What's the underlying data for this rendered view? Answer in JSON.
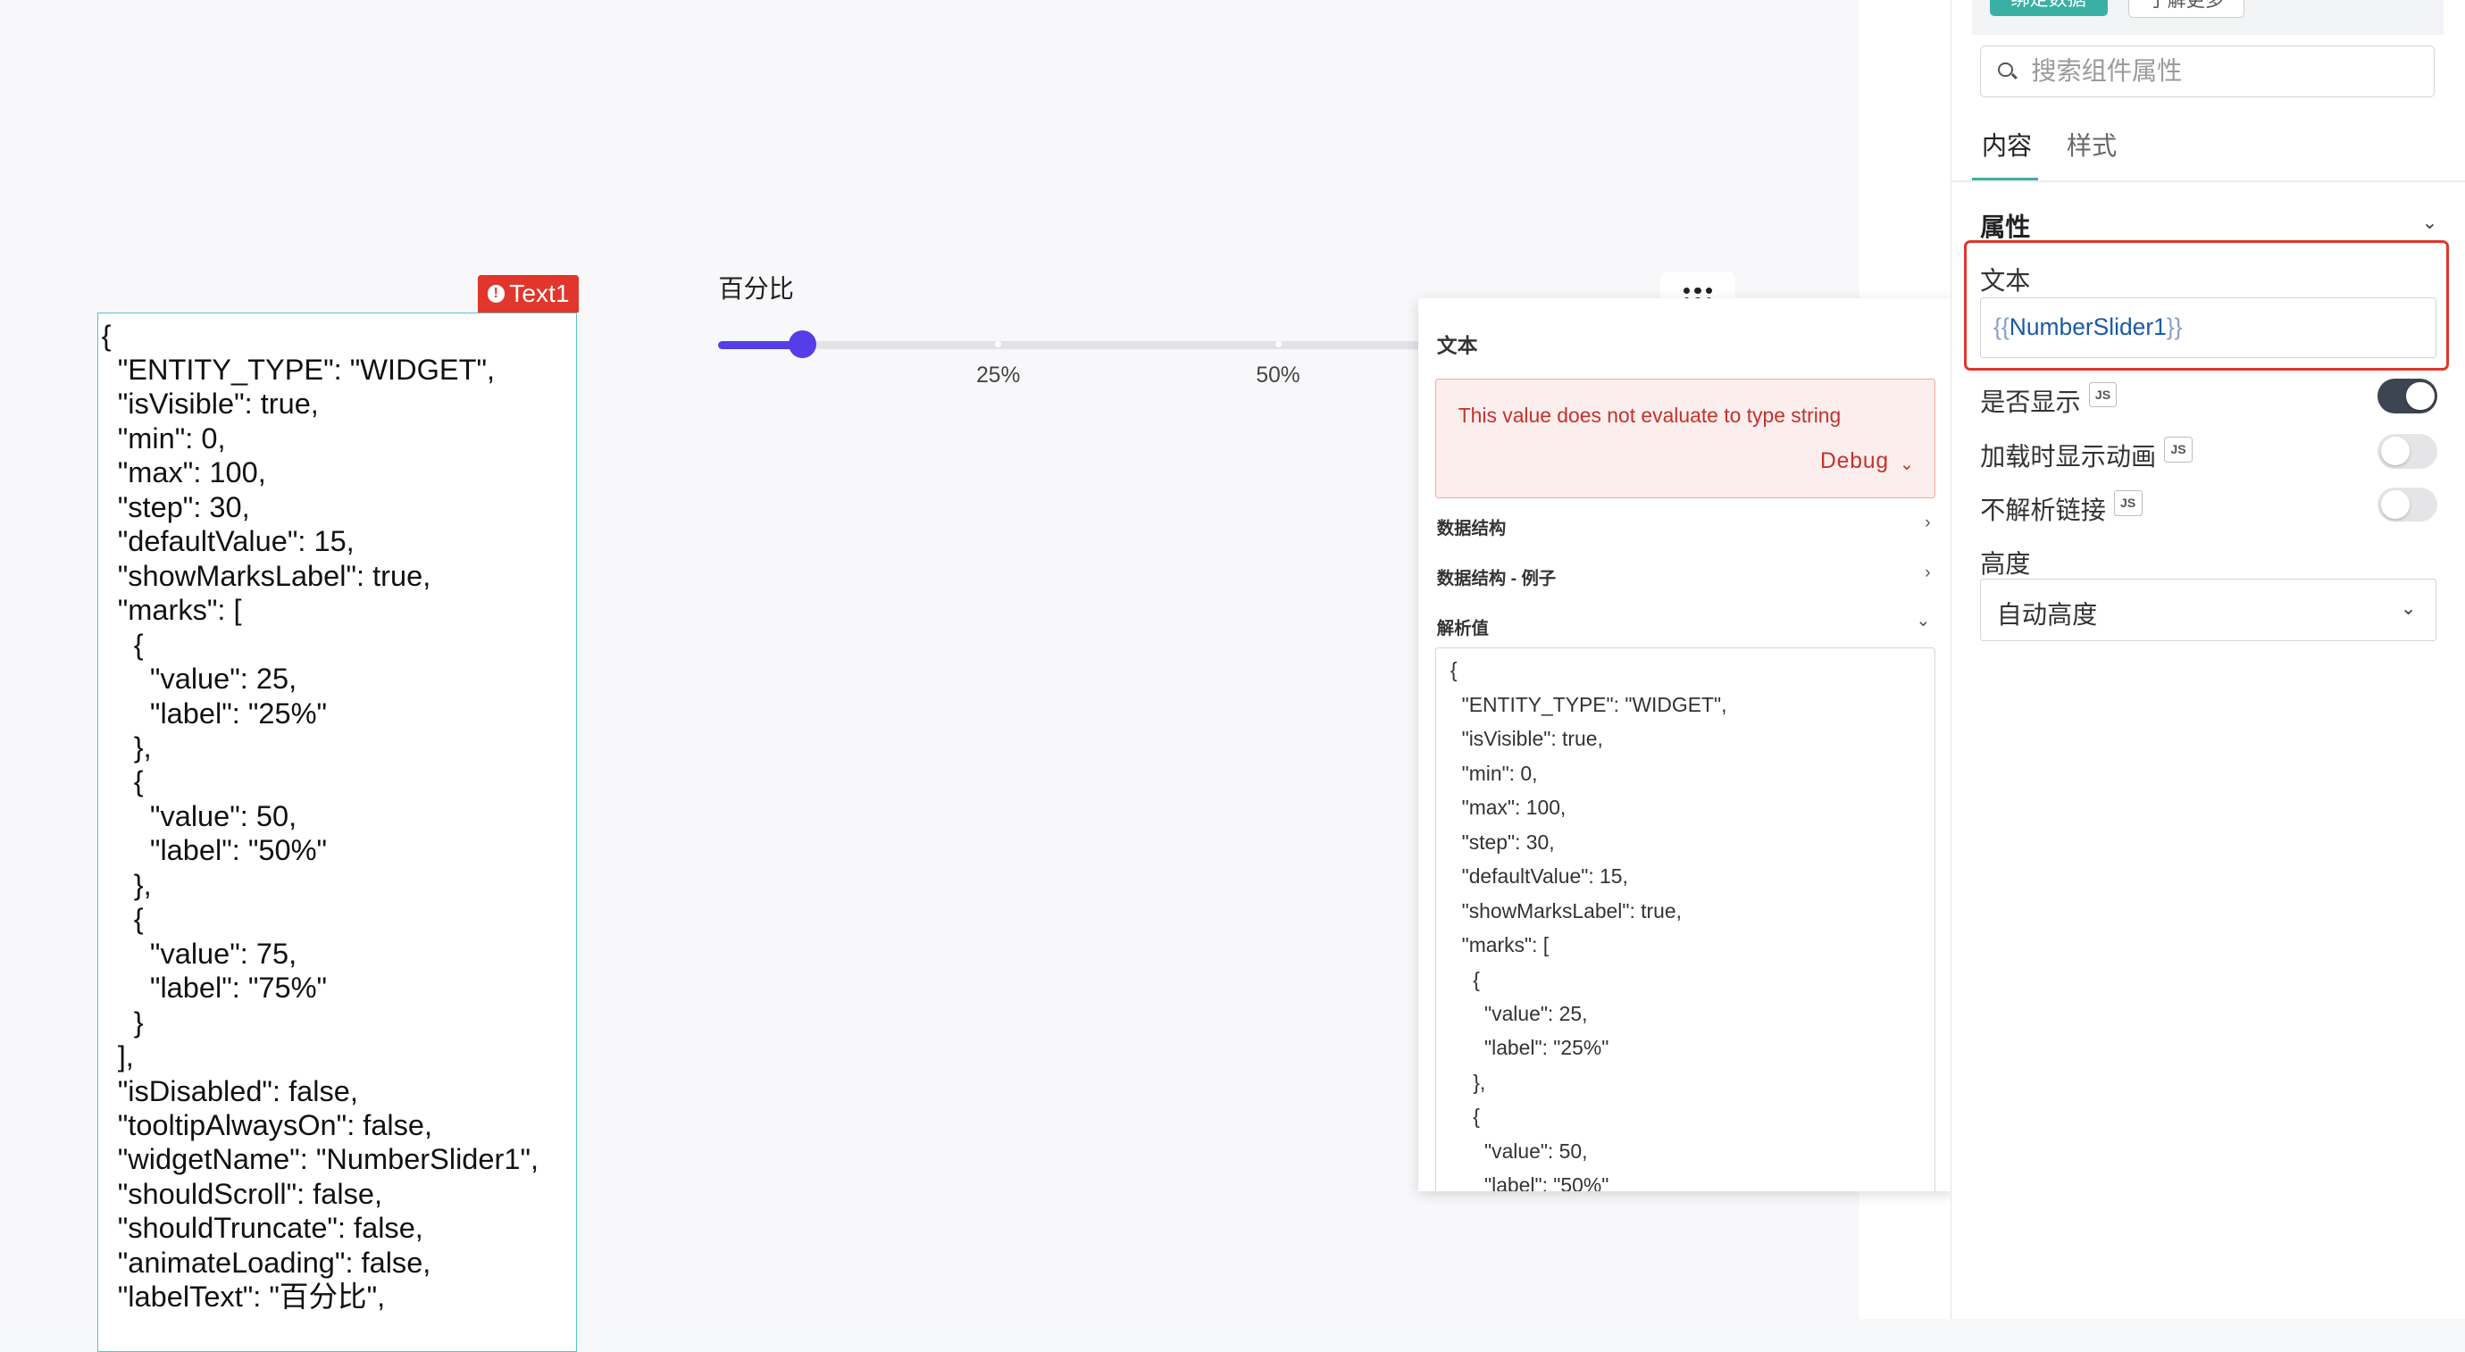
{
  "canvas": {
    "widget_tag": "Text1",
    "text_widget_content": "{\n  \"ENTITY_TYPE\": \"WIDGET\",\n  \"isVisible\": true,\n  \"min\": 0,\n  \"max\": 100,\n  \"step\": 30,\n  \"defaultValue\": 15,\n  \"showMarksLabel\": true,\n  \"marks\": [\n    {\n      \"value\": 25,\n      \"label\": \"25%\"\n    },\n    {\n      \"value\": 50,\n      \"label\": \"50%\"\n    },\n    {\n      \"value\": 75,\n      \"label\": \"75%\"\n    }\n  ],\n  \"isDisabled\": false,\n  \"tooltipAlwaysOn\": false,\n  \"widgetName\": \"NumberSlider1\",\n  \"shouldScroll\": false,\n  \"shouldTruncate\": false,\n  \"animateLoading\": false,\n  \"labelText\": \"百分比\",",
    "slider": {
      "label": "百分比",
      "min": 0,
      "max": 100,
      "value": 15,
      "marks": [
        {
          "value": 25,
          "label": "25%"
        },
        {
          "value": 50,
          "label": "50%"
        }
      ],
      "accent_color": "#553de9"
    }
  },
  "eval_popup": {
    "title": "文本",
    "error_message": "This value does not evaluate to type string",
    "debug_label": "Debug",
    "sections": {
      "data_structure": "数据结构",
      "data_structure_example": "数据结构 - 例子",
      "evaluated_value": "解析值"
    },
    "evaluated_value_content": "{\n  \"ENTITY_TYPE\": \"WIDGET\",\n  \"isVisible\": true,\n  \"min\": 0,\n  \"max\": 100,\n  \"step\": 30,\n  \"defaultValue\": 15,\n  \"showMarksLabel\": true,\n  \"marks\": [\n    {\n      \"value\": 25,\n      \"label\": \"25%\"\n    },\n    {\n      \"value\": 50,\n      \"label\": \"50%\"",
    "error_color": "#c5312b"
  },
  "property_panel": {
    "top_buttons": {
      "primary": "绑定数据",
      "secondary": "了解更多"
    },
    "search_placeholder": "搜索组件属性",
    "tabs": [
      "内容",
      "样式"
    ],
    "section_title": "属性",
    "text_field": {
      "label": "文本",
      "value_open": "{{",
      "value_binding": "NumberSlider1",
      "value_close": "}}"
    },
    "toggles": [
      {
        "label": "是否显示",
        "js": "JS",
        "on": true
      },
      {
        "label": "加载时显示动画",
        "js": "JS",
        "on": false
      },
      {
        "label": "不解析链接",
        "js": "JS",
        "on": false
      }
    ],
    "height_label": "高度",
    "height_value": "自动高度",
    "accent_color": "#3ab0a4"
  }
}
